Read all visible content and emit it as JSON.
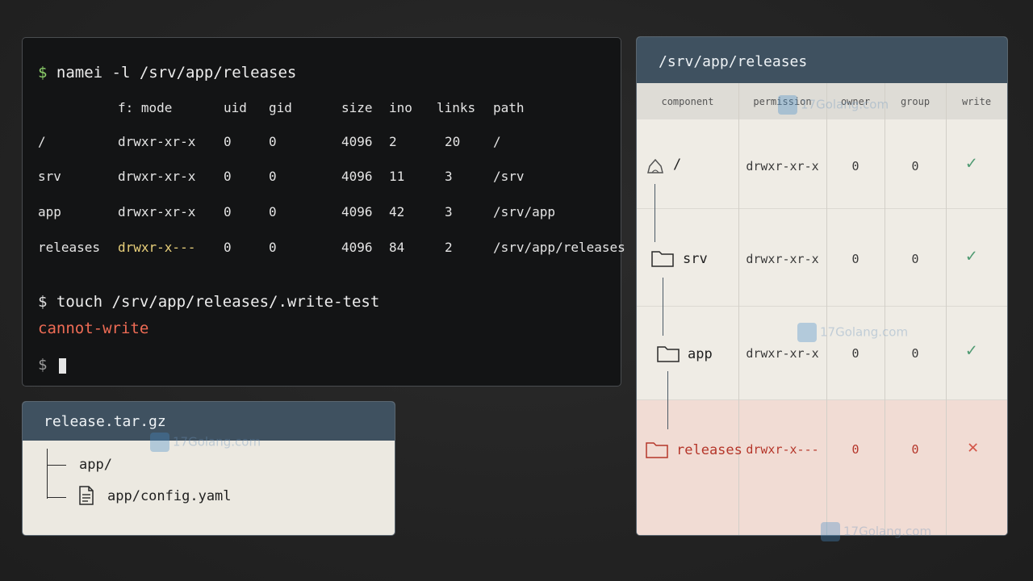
{
  "terminal": {
    "cmd1": "namei -l /srv/app/releases",
    "prompt": "$",
    "headers": [
      "f: mode",
      "uid",
      "gid",
      "size",
      "ino",
      "links",
      "path"
    ],
    "rows": [
      {
        "name": "/",
        "mode": "drwxr-xr-x",
        "uid": "0",
        "gid": "0",
        "size": "4096",
        "ino": "2",
        "links": "20",
        "path": "/"
      },
      {
        "name": "srv",
        "mode": "drwxr-xr-x",
        "uid": "0",
        "gid": "0",
        "size": "4096",
        "ino": "11",
        "links": "3",
        "path": "/srv"
      },
      {
        "name": "app",
        "mode": "drwxr-xr-x",
        "uid": "0",
        "gid": "0",
        "size": "4096",
        "ino": "42",
        "links": "3",
        "path": "/srv/app"
      },
      {
        "name": "releases",
        "mode": "drwxr-x---",
        "uid": "0",
        "gid": "0",
        "size": "4096",
        "ino": "84",
        "links": "2",
        "path": "/srv/app/releases"
      }
    ],
    "cmd2": "touch /srv/app/releases/.write-test",
    "error": "cannot-write"
  },
  "archive": {
    "title": "release.tar.gz",
    "items": [
      "app/",
      "app/config.yaml"
    ]
  },
  "path_panel": {
    "title": "/srv/app/releases",
    "columns": [
      "component",
      "permission",
      "owner",
      "group",
      "write"
    ],
    "rows": [
      {
        "name": "/",
        "permission": "drwxr-xr-x",
        "owner": "0",
        "group": "0",
        "write": "✓"
      },
      {
        "name": "srv",
        "permission": "drwxr-xr-x",
        "owner": "0",
        "group": "0",
        "write": "✓"
      },
      {
        "name": "app",
        "permission": "drwxr-xr-x",
        "owner": "0",
        "group": "0",
        "write": "✓"
      },
      {
        "name": "releases",
        "permission": "drwxr-x---",
        "owner": "0",
        "group": "0",
        "write": "✕"
      }
    ]
  },
  "watermark": "17Golang.com",
  "colors": {
    "prompt": "#8ccf6a",
    "error": "#ef6c55",
    "warn": "#e8cf7a",
    "header": "#3f5160",
    "ok": "#4f9a72",
    "bad": "#d4574a"
  }
}
